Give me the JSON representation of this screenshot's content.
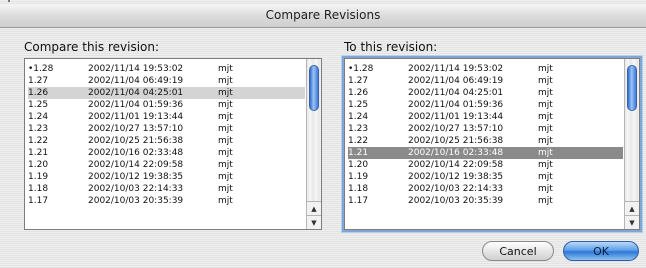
{
  "window": {
    "title": "Compare Revisions"
  },
  "left_panel": {
    "label": "Compare this revision:",
    "selected_revision": "1.26",
    "rows": [
      {
        "rev": "•1.28",
        "date": "2002/11/14 19:53:02",
        "author": "mjt"
      },
      {
        "rev": "1.27",
        "date": "2002/11/04 06:49:19",
        "author": "mjt"
      },
      {
        "rev": "1.26",
        "date": "2002/11/04 04:25:01",
        "author": "mjt"
      },
      {
        "rev": "1.25",
        "date": "2002/11/04 01:59:36",
        "author": "mjt"
      },
      {
        "rev": "1.24",
        "date": "2002/11/01 19:13:44",
        "author": "mjt"
      },
      {
        "rev": "1.23",
        "date": "2002/10/27 13:57:10",
        "author": "mjt"
      },
      {
        "rev": "1.22",
        "date": "2002/10/25 21:56:38",
        "author": "mjt"
      },
      {
        "rev": "1.21",
        "date": "2002/10/16 02:33:48",
        "author": "mjt"
      },
      {
        "rev": "1.20",
        "date": "2002/10/14 22:09:58",
        "author": "mjt"
      },
      {
        "rev": "1.19",
        "date": "2002/10/12 19:38:35",
        "author": "mjt"
      },
      {
        "rev": "1.18",
        "date": "2002/10/03 22:14:33",
        "author": "mjt"
      },
      {
        "rev": "1.17",
        "date": "2002/10/03 20:35:39",
        "author": "mjt"
      }
    ]
  },
  "right_panel": {
    "label": "To this revision:",
    "selected_revision": "1.21",
    "rows": [
      {
        "rev": "•1.28",
        "date": "2002/11/14 19:53:02",
        "author": "mjt"
      },
      {
        "rev": "1.27",
        "date": "2002/11/04 06:49:19",
        "author": "mjt"
      },
      {
        "rev": "1.26",
        "date": "2002/11/04 04:25:01",
        "author": "mjt"
      },
      {
        "rev": "1.25",
        "date": "2002/11/04 01:59:36",
        "author": "mjt"
      },
      {
        "rev": "1.24",
        "date": "2002/11/01 19:13:44",
        "author": "mjt"
      },
      {
        "rev": "1.23",
        "date": "2002/10/27 13:57:10",
        "author": "mjt"
      },
      {
        "rev": "1.22",
        "date": "2002/10/25 21:56:38",
        "author": "mjt"
      },
      {
        "rev": "1.21",
        "date": "2002/10/16 02:33:48",
        "author": "mjt"
      },
      {
        "rev": "1.20",
        "date": "2002/10/14 22:09:58",
        "author": "mjt"
      },
      {
        "rev": "1.19",
        "date": "2002/10/12 19:38:35",
        "author": "mjt"
      },
      {
        "rev": "1.18",
        "date": "2002/10/03 22:14:33",
        "author": "mjt"
      },
      {
        "rev": "1.17",
        "date": "2002/10/03 20:35:39",
        "author": "mjt"
      }
    ]
  },
  "buttons": {
    "cancel": "Cancel",
    "ok": "OK"
  },
  "icons": {
    "scroll_up": "up-arrow-icon",
    "scroll_down": "down-arrow-icon"
  },
  "colors": {
    "accent": "#3a7be0",
    "selection_dark": "#8a8a8a",
    "selection_light": "#d4d4d4"
  }
}
